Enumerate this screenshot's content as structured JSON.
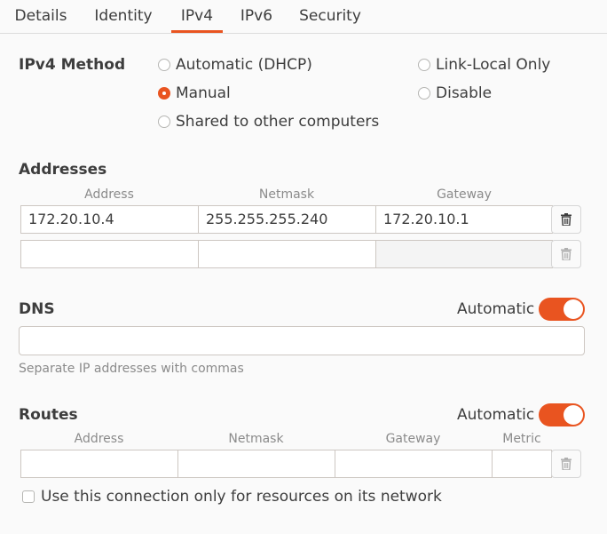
{
  "tabs": [
    {
      "label": "Details"
    },
    {
      "label": "Identity"
    },
    {
      "label": "IPv4"
    },
    {
      "label": "IPv6"
    },
    {
      "label": "Security"
    }
  ],
  "active_tab": "IPv4",
  "ipv4_method": {
    "label": "IPv4 Method",
    "options": [
      {
        "label": "Automatic (DHCP)",
        "checked": false
      },
      {
        "label": "Manual",
        "checked": true
      },
      {
        "label": "Shared to other computers",
        "checked": false
      },
      {
        "label": "Link-Local Only",
        "checked": false
      },
      {
        "label": "Disable",
        "checked": false
      }
    ]
  },
  "addresses": {
    "title": "Addresses",
    "columns": [
      "Address",
      "Netmask",
      "Gateway"
    ],
    "rows": [
      [
        "172.20.10.4",
        "255.255.255.240",
        "172.20.10.1"
      ],
      [
        "",
        "",
        ""
      ]
    ]
  },
  "dns": {
    "title": "DNS",
    "automatic_label": "Automatic",
    "automatic_on": true,
    "value": "",
    "hint": "Separate IP addresses with commas"
  },
  "routes": {
    "title": "Routes",
    "automatic_label": "Automatic",
    "automatic_on": true,
    "columns": [
      "Address",
      "Netmask",
      "Gateway",
      "Metric"
    ],
    "rows": [
      [
        "",
        "",
        "",
        ""
      ]
    ]
  },
  "local_only": {
    "label": "Use this connection only for resources on its network",
    "checked": false
  },
  "colors": {
    "accent": "#e95420",
    "text": "#3d3d3d",
    "muted": "#8b8b8b"
  }
}
